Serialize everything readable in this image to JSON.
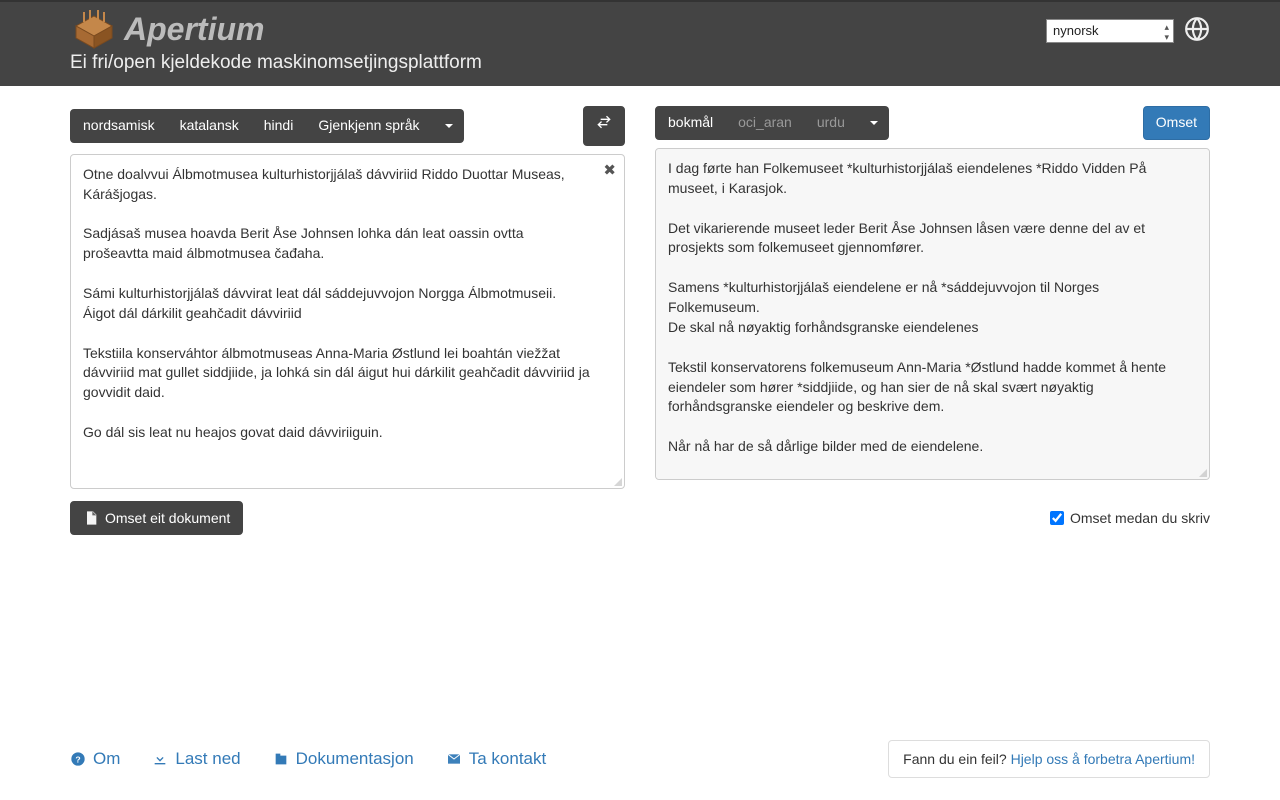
{
  "header": {
    "brand": "Apertium",
    "tagline": "Ei fri/open kjeldekode maskinomsetjingsplattform",
    "ui_language": "nynorsk"
  },
  "source": {
    "languages": [
      "nordsamisk",
      "katalansk",
      "hindi",
      "Gjenkjenn språk"
    ],
    "active_index": 0,
    "text": "Otne doalvvui Álbmotmusea kulturhistorjjálaš dávviriid Riddo Duottar Museas, Kárášjogas.\n\nSadjásaš musea hoavda Berit Åse Johnsen lohka dán leat oassin ovtta prošeavtta maid álbmotmusea čađaha.\n\nSámi kulturhistorjjálaš dávvirat leat dál sáddejuvvojon Norgga Álbmotmuseii.\nÁigot dál dárkilit geahčadit dávviriid\n\nTekstiila konserváhtor álbmotmuseas Anna-Maria Østlund lei boahtán viežžat dávviriid mat gullet siddjiide, ja lohká sin dál áigut hui dárkilit geahčadit dávviriid ja govvidit daid.\n\nGo dál sis leat nu heajos govat daid dávviriiguin."
  },
  "target": {
    "languages": [
      "bokmål",
      "oci_aran",
      "urdu"
    ],
    "active_index": 0,
    "translate_btn": "Omset",
    "text": "I dag førte han Folkemuseet *kulturhistorjjálaš eiendelenes *Riddo Vidden På museet, i Karasjok.\n\nDet vikarierende museet leder Berit Åse Johnsen låsen være denne del av et prosjekts som folkemuseet gjennomfører.\n\nSamens *kulturhistorjjálaš eiendelene er nå *sáddejuvvojon til Norges Folkemuseum.\nDe skal nå nøyaktig forhåndsgranske eiendelenes\n\nTekstil konservatorens folkemuseum Ann-Maria *Østlund hadde kommet å hente eiendeler som hører *siddjiide, og han sier de nå skal svært nøyaktig forhåndsgranske eiendeler og beskrive dem.\n\nNår nå har de så dårlige bilder med de eiendelene."
  },
  "actions": {
    "doc_translate": "Omset eit dokument",
    "instant_translate": "Omset medan du skriv",
    "instant_checked": true
  },
  "footer": {
    "links": [
      "Om",
      "Last ned",
      "Dokumentasjon",
      "Ta kontakt"
    ],
    "bug_prompt": "Fann du ein feil?",
    "bug_link": "Hjelp oss å forbetra Apertium!"
  }
}
